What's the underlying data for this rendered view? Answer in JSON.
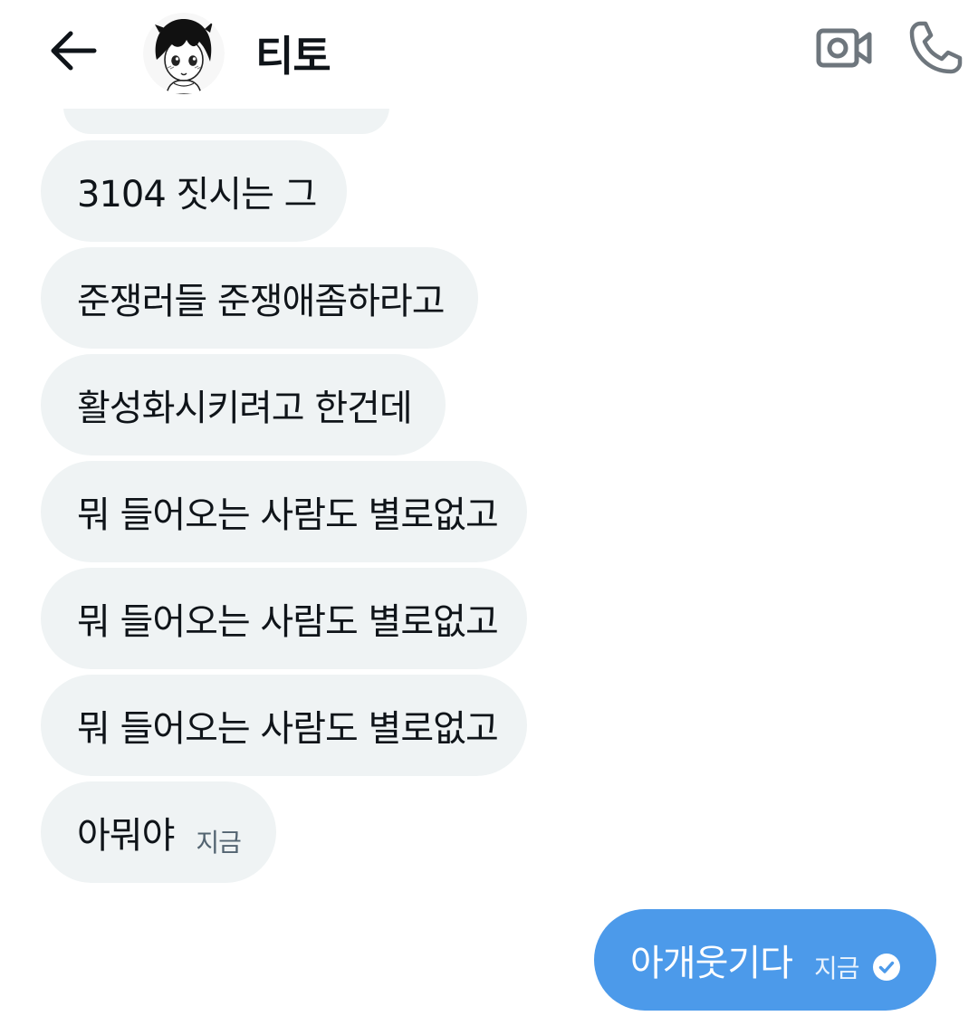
{
  "header": {
    "contact_name": "티토",
    "icons": [
      "back-arrow-icon",
      "avatar",
      "video-call-icon",
      "phone-icon"
    ]
  },
  "messages": {
    "incoming": [
      {
        "text": "3104 짓시는 그"
      },
      {
        "text": "준쟁러들 준쟁애좀하라고"
      },
      {
        "text": "활성화시키려고 한건데"
      },
      {
        "text": "뭐 들어오는 사람도 별로없고"
      },
      {
        "text": "뭐 들어오는 사람도 별로없고"
      },
      {
        "text": "뭐 들어오는 사람도 별로없고"
      },
      {
        "text": "아뭐야",
        "time": "지금"
      }
    ],
    "outgoing": [
      {
        "text": "아개웃기다",
        "time": "지금",
        "status": "read"
      }
    ]
  },
  "colors": {
    "incoming_bubble": "#eff3f4",
    "outgoing_bubble": "#4c9aea",
    "text": "#0f1419",
    "timestamp": "#536471"
  }
}
